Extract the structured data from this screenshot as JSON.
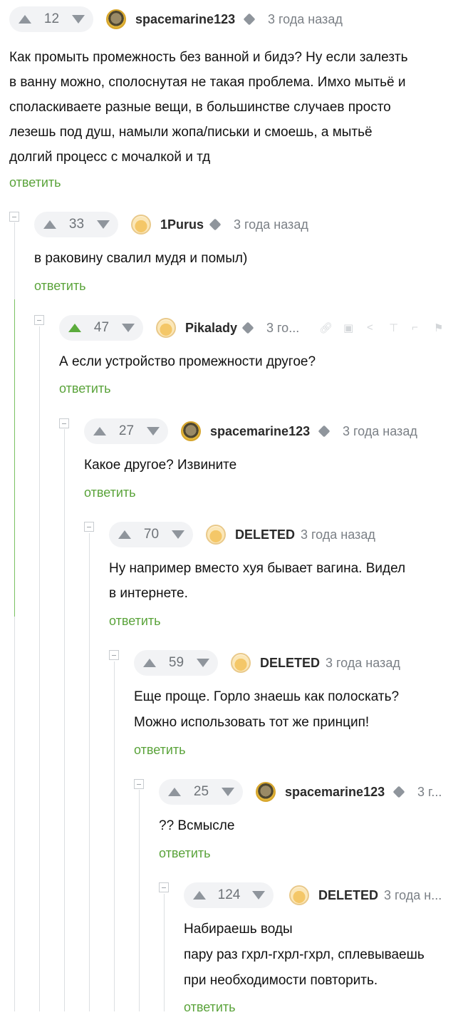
{
  "comments": [
    {
      "score": "12",
      "user": "spacemarine123",
      "time": "3 года назад",
      "avatar": "portrait-avatar",
      "lines": [
        "Как промыть промежность без ванной и бидэ? Ну если залезть",
        "в ванну можно, сполоснутая не такая проблема. Имхо мытьё и",
        "споласкиваете разные вещи, в большинстве случаев просто",
        "лезешь под душ, намыли жопа/письки и смоешь, а мытьё",
        "долгий процесс с мочалкой и тд"
      ],
      "reply": "ответить"
    },
    {
      "score": "33",
      "user": "1Purus",
      "time": "3 года назад",
      "avatar": "pikabu-avatar",
      "lines": [
        "в раковину свалил мудя и помыл)"
      ],
      "reply": "ответить"
    },
    {
      "score": "47",
      "user": "Pikalady",
      "time": "3 го...",
      "avatar": "pikabu-avatar",
      "lines": [
        "А если устройство промежности другое?"
      ],
      "reply": "ответить"
    },
    {
      "score": "27",
      "user": "spacemarine123",
      "time": "3 года назад",
      "avatar": "portrait-avatar",
      "lines": [
        "Какое другое? Извините"
      ],
      "reply": "ответить"
    },
    {
      "score": "70",
      "user": "DELETED",
      "time": "3 года назад",
      "avatar": "pikabu-avatar",
      "lines": [
        "Ну например вместо хуя бывает вагина. Видел",
        "в интернете."
      ],
      "reply": "ответить"
    },
    {
      "score": "59",
      "user": "DELETED",
      "time": "3 года назад",
      "avatar": "pikabu-avatar",
      "lines": [
        "Еще проще. Горло знаешь как полоскать?",
        "Можно использовать тот же принцип!"
      ],
      "reply": "ответить"
    },
    {
      "score": "25",
      "user": "spacemarine123",
      "time": "3 г...",
      "avatar": "portrait-avatar",
      "lines": [
        "?? Всмысле"
      ],
      "reply": "ответить"
    },
    {
      "score": "124",
      "user": "DELETED",
      "time": "3 года н...",
      "avatar": "pikabu-avatar",
      "lines": [
        "Набираешь воды",
        "пару раз гхрл-гхрл-гхрл, сплевываешь",
        "при необходимости повторить."
      ],
      "reply": "ответить"
    }
  ],
  "action_icons": [
    "link-icon",
    "save-icon",
    "share-icon",
    "pin-icon",
    "hand-icon",
    "report-flag-icon"
  ],
  "colors": {
    "accent_green": "#5bab3c",
    "reply_green": "#5aa33a",
    "vote_bg": "#f2f3f5",
    "muted": "#8f959c"
  }
}
